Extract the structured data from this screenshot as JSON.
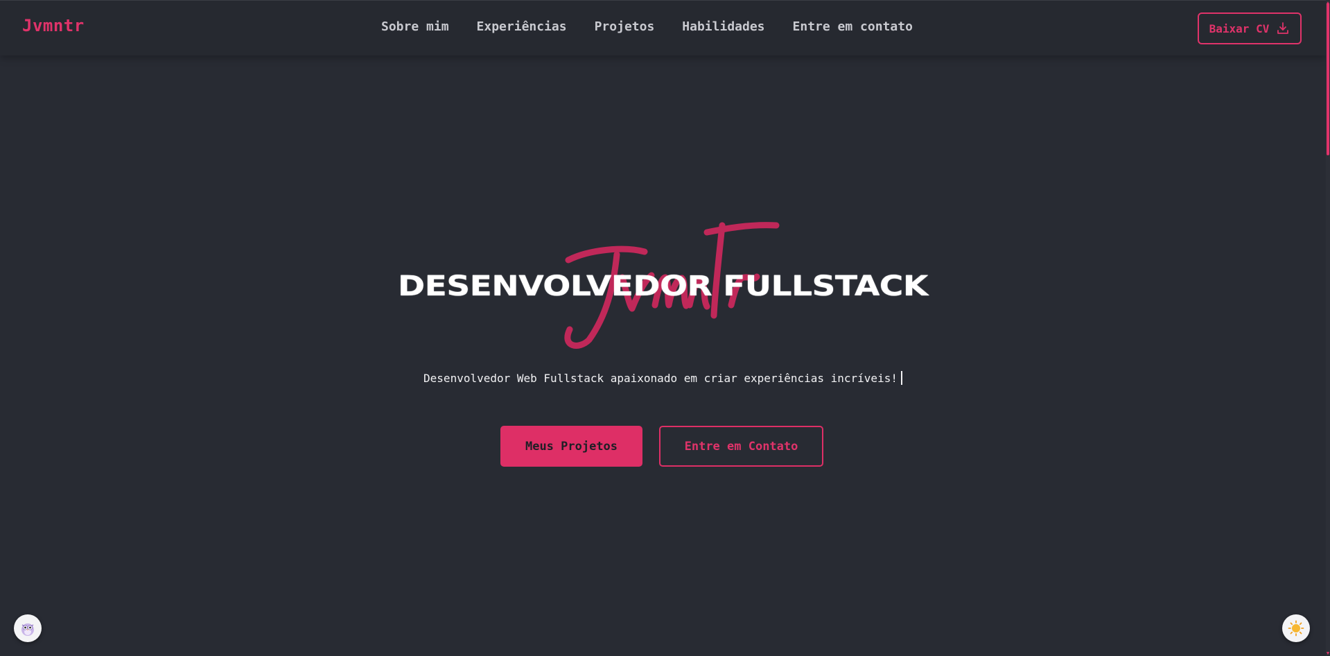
{
  "header": {
    "logo": "Jvmntr",
    "nav": [
      {
        "label": "Sobre mim"
      },
      {
        "label": "Experiências"
      },
      {
        "label": "Projetos"
      },
      {
        "label": "Habilidades"
      },
      {
        "label": "Entre em contato"
      }
    ],
    "cv_button": {
      "label": "Baixar CV",
      "icon": "download-icon"
    }
  },
  "hero": {
    "signature": "Jvmntr",
    "title": "DESENVOLVEDOR FULLSTACK",
    "subtitle": "Desenvolvedor Web Fullstack apaixonado em criar experiências incríveis!",
    "primary_button": "Meus Projetos",
    "secondary_button": "Entre em Contato"
  },
  "floating": {
    "left_icon": "owl-icon",
    "right_icon": "sun-icon"
  },
  "colors": {
    "background": "#282b33",
    "header": "#262930",
    "accent": "#e0336a",
    "text": "#ffffff",
    "nav_text": "#c9cad0"
  }
}
